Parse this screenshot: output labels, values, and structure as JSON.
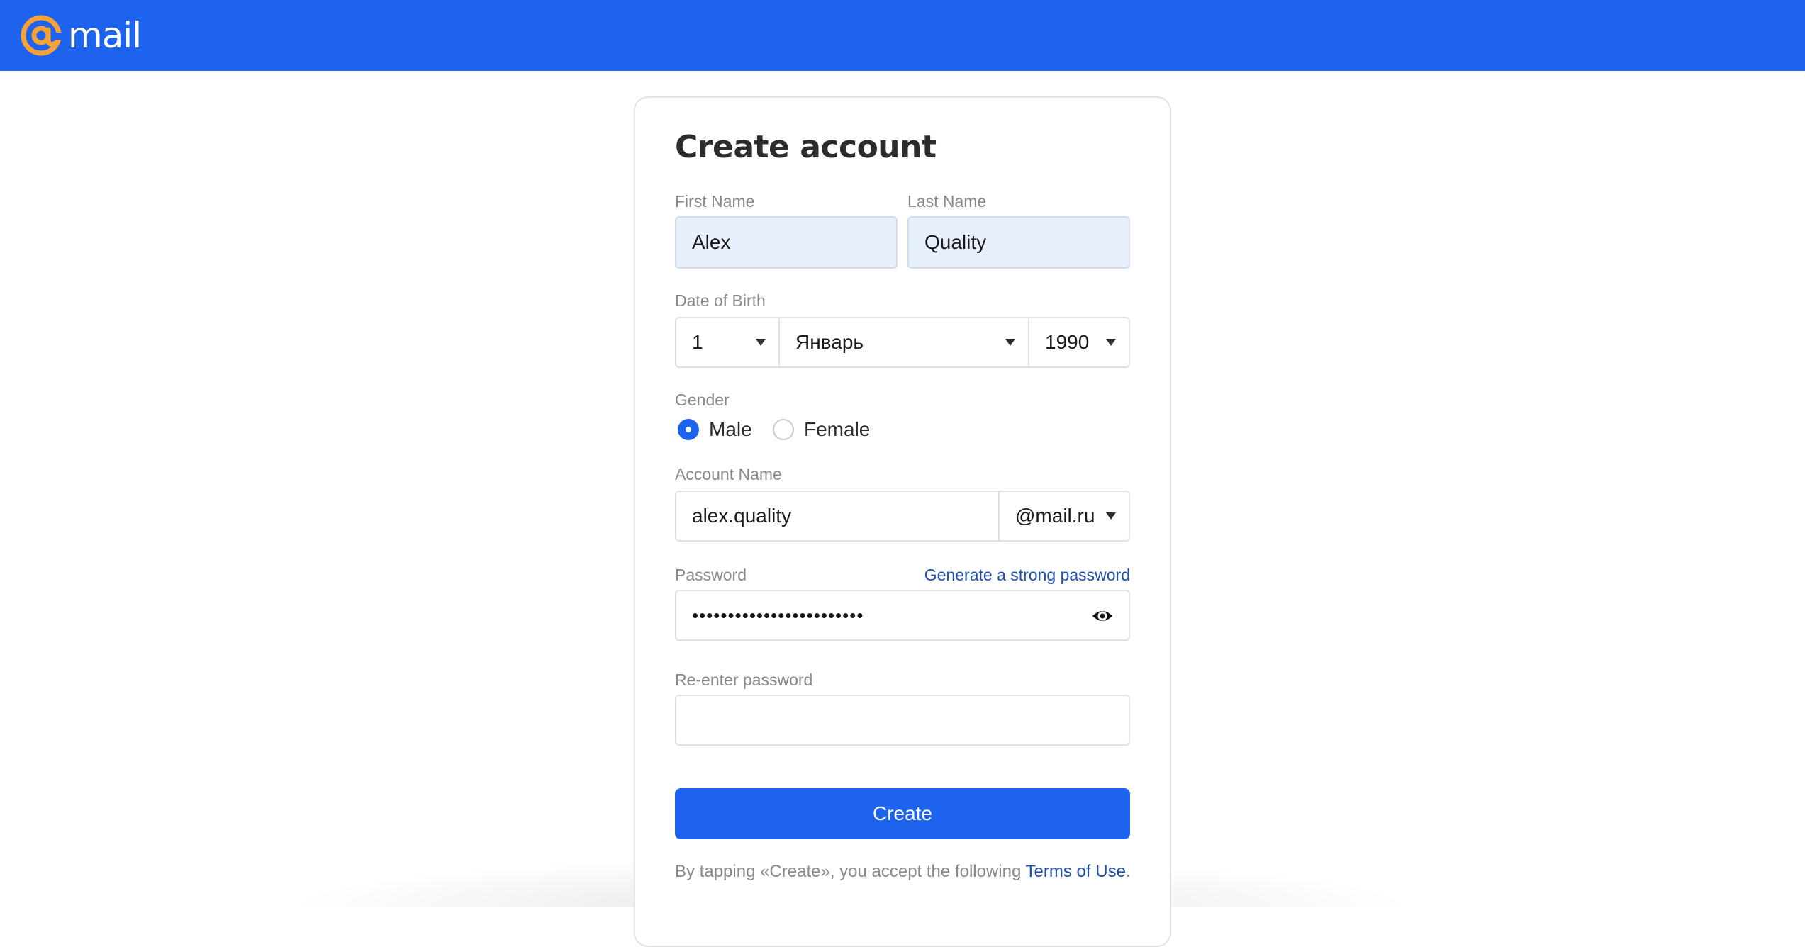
{
  "brand": {
    "name": "mail",
    "accent": "#1e63ee",
    "logo_at_color": "#f7a137"
  },
  "form": {
    "title": "Create account",
    "first_name": {
      "label": "First Name",
      "value": "Alex"
    },
    "last_name": {
      "label": "Last Name",
      "value": "Quality"
    },
    "dob": {
      "label": "Date of Birth",
      "day": "1",
      "month": "Январь",
      "year": "1990"
    },
    "gender": {
      "label": "Gender",
      "options": [
        "Male",
        "Female"
      ],
      "selected": "Male"
    },
    "account": {
      "label": "Account Name",
      "value": "alex.quality",
      "domain": "@mail.ru"
    },
    "password": {
      "label": "Password",
      "generate_link": "Generate a strong password",
      "masked_value": "••••••••••••••••••••••••"
    },
    "reenter": {
      "label": "Re-enter password",
      "value": ""
    },
    "create_button": "Create",
    "terms": {
      "text": "By tapping «Create», you accept the following",
      "link": "Terms of Use",
      "suffix": "."
    }
  },
  "icons": {
    "logo": "at-sign-icon",
    "dropdown": "caret-down-icon",
    "show_password": "eye-icon"
  }
}
